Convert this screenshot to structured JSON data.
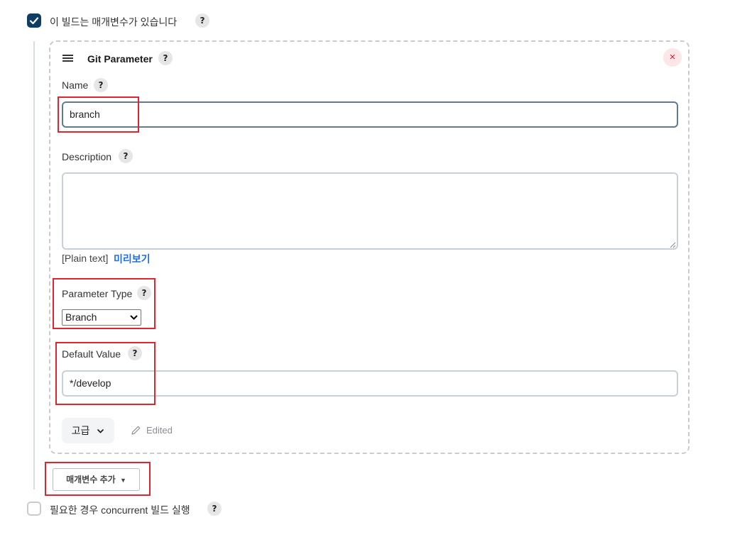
{
  "params_checkbox": {
    "label": "이 빌드는 매개변수가 있습니다",
    "checked": true,
    "help": "?"
  },
  "param_card": {
    "title": "Git Parameter",
    "help": "?",
    "close": "×",
    "name": {
      "label": "Name",
      "help": "?",
      "value": "branch"
    },
    "description": {
      "label": "Description",
      "help": "?",
      "value": "",
      "plain_text": "[Plain text]",
      "preview_link": "미리보기"
    },
    "parameter_type": {
      "label": "Parameter Type",
      "help": "?",
      "selected": "Branch"
    },
    "default_value": {
      "label": "Default Value",
      "help": "?",
      "value": "*/develop"
    },
    "advanced_button": "고급",
    "edited_label": "Edited"
  },
  "add_param_button": "매개변수 추가",
  "concurrent_checkbox": {
    "label": "필요한 경우 concurrent 빌드 실행",
    "checked": false,
    "help": "?"
  },
  "colors": {
    "accent": "#0f3d66",
    "link": "#1f6feb",
    "highlight": "#e0252e"
  }
}
